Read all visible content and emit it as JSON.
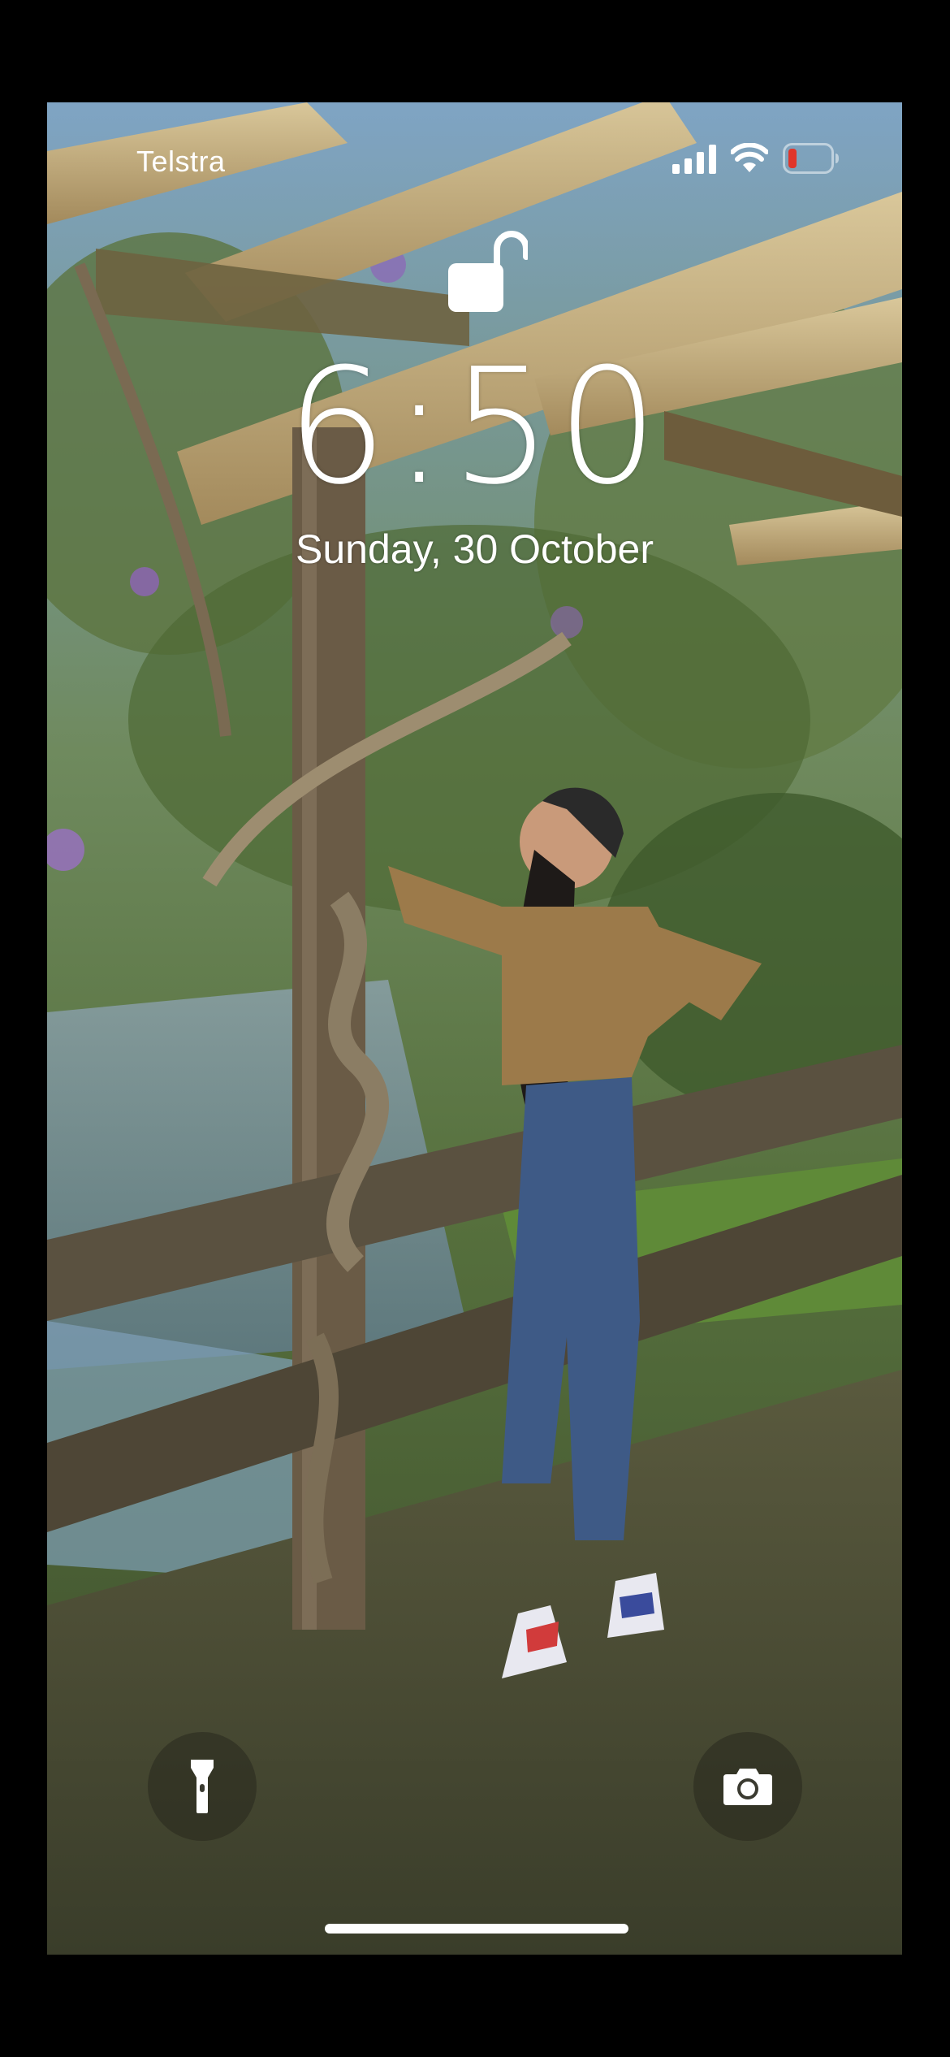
{
  "status_bar": {
    "carrier": "Telstra",
    "icons": [
      "cellular-signal-icon",
      "wifi-icon",
      "battery-low-icon"
    ],
    "battery_color": "#e0352b"
  },
  "lock_screen": {
    "lock_state_icon": "unlocked-padlock-icon",
    "time": "6:50",
    "date": "Sunday, 30 October"
  },
  "quick_actions": {
    "left": "flashlight-icon",
    "right": "camera-icon"
  },
  "wallpaper": {
    "description_icon": "photo-wallpaper"
  }
}
